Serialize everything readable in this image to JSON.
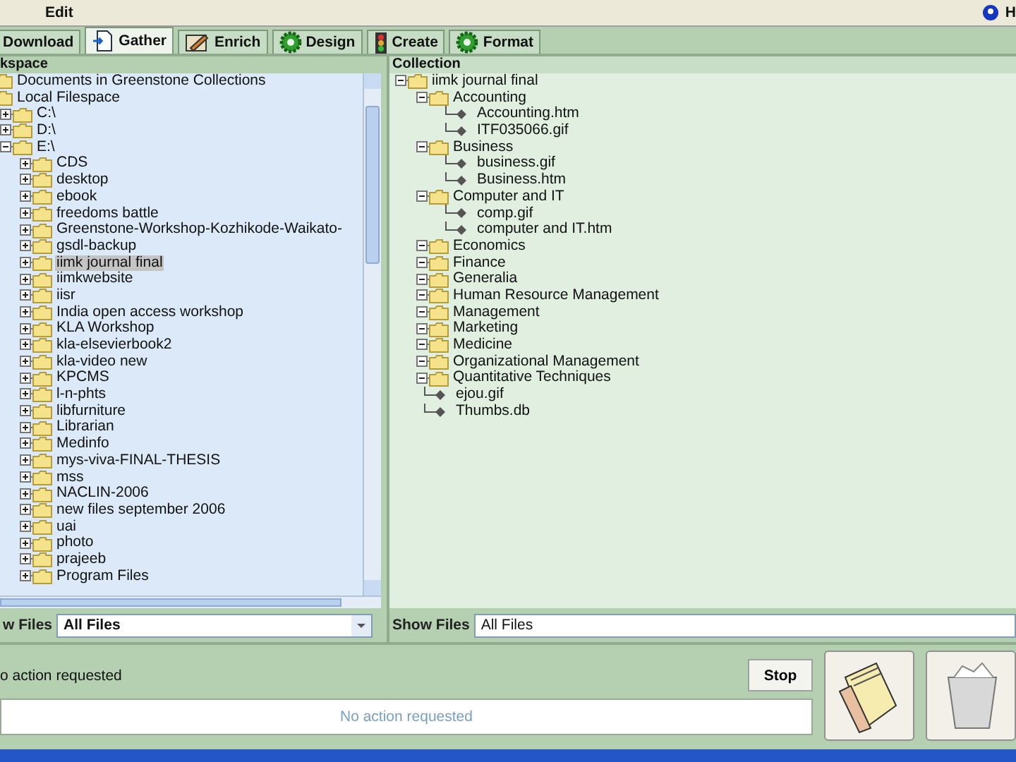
{
  "menu": [
    "Edit",
    "H"
  ],
  "tabs": [
    {
      "label": "Download",
      "selected": false,
      "kind": "plain"
    },
    {
      "label": "Gather",
      "selected": true,
      "kind": "gather"
    },
    {
      "label": "Enrich",
      "selected": false,
      "kind": "enrich"
    },
    {
      "label": "Design",
      "selected": false,
      "kind": "gear"
    },
    {
      "label": "Create",
      "selected": false,
      "kind": "create"
    },
    {
      "label": "Format",
      "selected": false,
      "kind": "gear"
    }
  ],
  "workspace": {
    "title": "kspace",
    "show_files_label": "w Files",
    "filter": "All Files",
    "tree": [
      {
        "label": "Documents in Greenstone Collections",
        "kind": "folder",
        "selected": false
      },
      {
        "label": "Local Filespace",
        "kind": "folder",
        "selected": false,
        "children": [
          {
            "label": "C:\\",
            "kind": "folder",
            "expanded": false,
            "selected": false
          },
          {
            "label": "D:\\",
            "kind": "folder",
            "expanded": false,
            "selected": false
          },
          {
            "label": "E:\\",
            "kind": "folder",
            "expanded": true,
            "selected": false,
            "children": [
              {
                "label": "CDS",
                "kind": "folder",
                "expanded": false,
                "selected": false
              },
              {
                "label": "desktop",
                "kind": "folder",
                "expanded": false,
                "selected": false
              },
              {
                "label": "ebook",
                "kind": "folder",
                "expanded": false,
                "selected": false
              },
              {
                "label": "freedoms battle",
                "kind": "folder",
                "expanded": false,
                "selected": false
              },
              {
                "label": "Greenstone-Workshop-Kozhikode-Waikato-",
                "kind": "folder",
                "expanded": false,
                "selected": false
              },
              {
                "label": "gsdl-backup",
                "kind": "folder",
                "expanded": false,
                "selected": false
              },
              {
                "label": "iimk journal final",
                "kind": "folder",
                "expanded": false,
                "selected": true
              },
              {
                "label": "iimkwebsite",
                "kind": "folder",
                "expanded": false,
                "selected": false
              },
              {
                "label": "iisr",
                "kind": "folder",
                "expanded": false,
                "selected": false
              },
              {
                "label": "India open access workshop",
                "kind": "folder",
                "expanded": false,
                "selected": false
              },
              {
                "label": "KLA Workshop",
                "kind": "folder",
                "expanded": false,
                "selected": false
              },
              {
                "label": "kla-elsevierbook2",
                "kind": "folder",
                "expanded": false,
                "selected": false
              },
              {
                "label": "kla-video new",
                "kind": "folder",
                "expanded": false,
                "selected": false
              },
              {
                "label": "KPCMS",
                "kind": "folder",
                "expanded": false,
                "selected": false
              },
              {
                "label": "l-n-phts",
                "kind": "folder",
                "expanded": false,
                "selected": false
              },
              {
                "label": "libfurniture",
                "kind": "folder",
                "expanded": false,
                "selected": false
              },
              {
                "label": "Librarian",
                "kind": "folder",
                "expanded": false,
                "selected": false
              },
              {
                "label": "Medinfo",
                "kind": "folder",
                "expanded": false,
                "selected": false
              },
              {
                "label": "mys-viva-FINAL-THESIS",
                "kind": "folder",
                "expanded": false,
                "selected": false
              },
              {
                "label": "mss",
                "kind": "folder",
                "expanded": false,
                "selected": false
              },
              {
                "label": "NACLIN-2006",
                "kind": "folder",
                "expanded": false,
                "selected": false
              },
              {
                "label": "new files september 2006",
                "kind": "folder",
                "expanded": false,
                "selected": false
              },
              {
                "label": "uai",
                "kind": "folder",
                "expanded": false,
                "selected": false
              },
              {
                "label": "photo",
                "kind": "folder",
                "expanded": false,
                "selected": false
              },
              {
                "label": "prajeeb",
                "kind": "folder",
                "expanded": false,
                "selected": false
              },
              {
                "label": "Program Files",
                "kind": "folder",
                "expanded": false,
                "selected": false
              }
            ]
          }
        ]
      }
    ]
  },
  "collection": {
    "title": "Collection",
    "show_files_label": "Show Files",
    "filter": "All Files",
    "tree": [
      {
        "label": "iimk journal final",
        "kind": "folder",
        "expanded": true,
        "children": [
          {
            "label": "Accounting",
            "kind": "folder",
            "expanded": true,
            "children": [
              {
                "label": "Accounting.htm",
                "kind": "file"
              },
              {
                "label": "ITF035066.gif",
                "kind": "file"
              }
            ]
          },
          {
            "label": "Business",
            "kind": "folder",
            "expanded": true,
            "children": [
              {
                "label": "business.gif",
                "kind": "file"
              },
              {
                "label": "Business.htm",
                "kind": "file"
              }
            ]
          },
          {
            "label": "Computer and IT",
            "kind": "folder",
            "expanded": true,
            "children": [
              {
                "label": "comp.gif",
                "kind": "file"
              },
              {
                "label": "computer and IT.htm",
                "kind": "file"
              }
            ]
          },
          {
            "label": "Economics",
            "kind": "folder",
            "expanded": true
          },
          {
            "label": "Finance",
            "kind": "folder",
            "expanded": true
          },
          {
            "label": "Generalia",
            "kind": "folder",
            "expanded": true
          },
          {
            "label": "Human Resource Management",
            "kind": "folder",
            "expanded": true
          },
          {
            "label": "Management",
            "kind": "folder",
            "expanded": true
          },
          {
            "label": "Marketing",
            "kind": "folder",
            "expanded": true
          },
          {
            "label": "Medicine",
            "kind": "folder",
            "expanded": true
          },
          {
            "label": "Organizational Management",
            "kind": "folder",
            "expanded": true
          },
          {
            "label": "Quantitative Techniques",
            "kind": "folder",
            "expanded": true
          },
          {
            "label": "ejou.gif",
            "kind": "file"
          },
          {
            "label": "Thumbs.db",
            "kind": "file"
          }
        ]
      }
    ]
  },
  "status": {
    "label": "o action requested",
    "button": "Stop",
    "progress_text": "No action requested"
  }
}
